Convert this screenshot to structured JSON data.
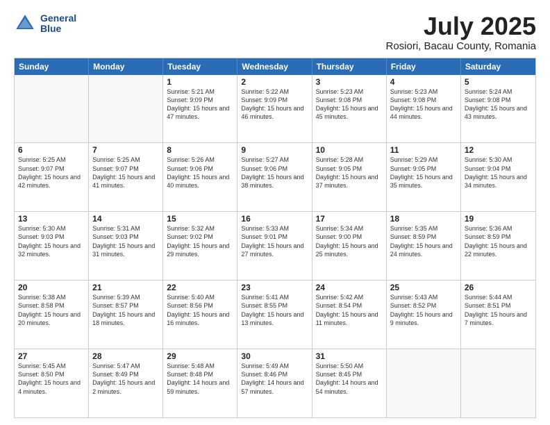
{
  "header": {
    "logo_line1": "General",
    "logo_line2": "Blue",
    "month": "July 2025",
    "location": "Rosiori, Bacau County, Romania"
  },
  "weekdays": [
    "Sunday",
    "Monday",
    "Tuesday",
    "Wednesday",
    "Thursday",
    "Friday",
    "Saturday"
  ],
  "rows": [
    [
      {
        "day": "",
        "empty": true
      },
      {
        "day": "",
        "empty": true
      },
      {
        "day": "1",
        "sunrise": "Sunrise: 5:21 AM",
        "sunset": "Sunset: 9:09 PM",
        "daylight": "Daylight: 15 hours and 47 minutes."
      },
      {
        "day": "2",
        "sunrise": "Sunrise: 5:22 AM",
        "sunset": "Sunset: 9:09 PM",
        "daylight": "Daylight: 15 hours and 46 minutes."
      },
      {
        "day": "3",
        "sunrise": "Sunrise: 5:23 AM",
        "sunset": "Sunset: 9:08 PM",
        "daylight": "Daylight: 15 hours and 45 minutes."
      },
      {
        "day": "4",
        "sunrise": "Sunrise: 5:23 AM",
        "sunset": "Sunset: 9:08 PM",
        "daylight": "Daylight: 15 hours and 44 minutes."
      },
      {
        "day": "5",
        "sunrise": "Sunrise: 5:24 AM",
        "sunset": "Sunset: 9:08 PM",
        "daylight": "Daylight: 15 hours and 43 minutes."
      }
    ],
    [
      {
        "day": "6",
        "sunrise": "Sunrise: 5:25 AM",
        "sunset": "Sunset: 9:07 PM",
        "daylight": "Daylight: 15 hours and 42 minutes."
      },
      {
        "day": "7",
        "sunrise": "Sunrise: 5:25 AM",
        "sunset": "Sunset: 9:07 PM",
        "daylight": "Daylight: 15 hours and 41 minutes."
      },
      {
        "day": "8",
        "sunrise": "Sunrise: 5:26 AM",
        "sunset": "Sunset: 9:06 PM",
        "daylight": "Daylight: 15 hours and 40 minutes."
      },
      {
        "day": "9",
        "sunrise": "Sunrise: 5:27 AM",
        "sunset": "Sunset: 9:06 PM",
        "daylight": "Daylight: 15 hours and 38 minutes."
      },
      {
        "day": "10",
        "sunrise": "Sunrise: 5:28 AM",
        "sunset": "Sunset: 9:05 PM",
        "daylight": "Daylight: 15 hours and 37 minutes."
      },
      {
        "day": "11",
        "sunrise": "Sunrise: 5:29 AM",
        "sunset": "Sunset: 9:05 PM",
        "daylight": "Daylight: 15 hours and 35 minutes."
      },
      {
        "day": "12",
        "sunrise": "Sunrise: 5:30 AM",
        "sunset": "Sunset: 9:04 PM",
        "daylight": "Daylight: 15 hours and 34 minutes."
      }
    ],
    [
      {
        "day": "13",
        "sunrise": "Sunrise: 5:30 AM",
        "sunset": "Sunset: 9:03 PM",
        "daylight": "Daylight: 15 hours and 32 minutes."
      },
      {
        "day": "14",
        "sunrise": "Sunrise: 5:31 AM",
        "sunset": "Sunset: 9:03 PM",
        "daylight": "Daylight: 15 hours and 31 minutes."
      },
      {
        "day": "15",
        "sunrise": "Sunrise: 5:32 AM",
        "sunset": "Sunset: 9:02 PM",
        "daylight": "Daylight: 15 hours and 29 minutes."
      },
      {
        "day": "16",
        "sunrise": "Sunrise: 5:33 AM",
        "sunset": "Sunset: 9:01 PM",
        "daylight": "Daylight: 15 hours and 27 minutes."
      },
      {
        "day": "17",
        "sunrise": "Sunrise: 5:34 AM",
        "sunset": "Sunset: 9:00 PM",
        "daylight": "Daylight: 15 hours and 25 minutes."
      },
      {
        "day": "18",
        "sunrise": "Sunrise: 5:35 AM",
        "sunset": "Sunset: 8:59 PM",
        "daylight": "Daylight: 15 hours and 24 minutes."
      },
      {
        "day": "19",
        "sunrise": "Sunrise: 5:36 AM",
        "sunset": "Sunset: 8:59 PM",
        "daylight": "Daylight: 15 hours and 22 minutes."
      }
    ],
    [
      {
        "day": "20",
        "sunrise": "Sunrise: 5:38 AM",
        "sunset": "Sunset: 8:58 PM",
        "daylight": "Daylight: 15 hours and 20 minutes."
      },
      {
        "day": "21",
        "sunrise": "Sunrise: 5:39 AM",
        "sunset": "Sunset: 8:57 PM",
        "daylight": "Daylight: 15 hours and 18 minutes."
      },
      {
        "day": "22",
        "sunrise": "Sunrise: 5:40 AM",
        "sunset": "Sunset: 8:56 PM",
        "daylight": "Daylight: 15 hours and 16 minutes."
      },
      {
        "day": "23",
        "sunrise": "Sunrise: 5:41 AM",
        "sunset": "Sunset: 8:55 PM",
        "daylight": "Daylight: 15 hours and 13 minutes."
      },
      {
        "day": "24",
        "sunrise": "Sunrise: 5:42 AM",
        "sunset": "Sunset: 8:54 PM",
        "daylight": "Daylight: 15 hours and 11 minutes."
      },
      {
        "day": "25",
        "sunrise": "Sunrise: 5:43 AM",
        "sunset": "Sunset: 8:52 PM",
        "daylight": "Daylight: 15 hours and 9 minutes."
      },
      {
        "day": "26",
        "sunrise": "Sunrise: 5:44 AM",
        "sunset": "Sunset: 8:51 PM",
        "daylight": "Daylight: 15 hours and 7 minutes."
      }
    ],
    [
      {
        "day": "27",
        "sunrise": "Sunrise: 5:45 AM",
        "sunset": "Sunset: 8:50 PM",
        "daylight": "Daylight: 15 hours and 4 minutes."
      },
      {
        "day": "28",
        "sunrise": "Sunrise: 5:47 AM",
        "sunset": "Sunset: 8:49 PM",
        "daylight": "Daylight: 15 hours and 2 minutes."
      },
      {
        "day": "29",
        "sunrise": "Sunrise: 5:48 AM",
        "sunset": "Sunset: 8:48 PM",
        "daylight": "Daylight: 14 hours and 59 minutes."
      },
      {
        "day": "30",
        "sunrise": "Sunrise: 5:49 AM",
        "sunset": "Sunset: 8:46 PM",
        "daylight": "Daylight: 14 hours and 57 minutes."
      },
      {
        "day": "31",
        "sunrise": "Sunrise: 5:50 AM",
        "sunset": "Sunset: 8:45 PM",
        "daylight": "Daylight: 14 hours and 54 minutes."
      },
      {
        "day": "",
        "empty": true
      },
      {
        "day": "",
        "empty": true
      }
    ]
  ]
}
